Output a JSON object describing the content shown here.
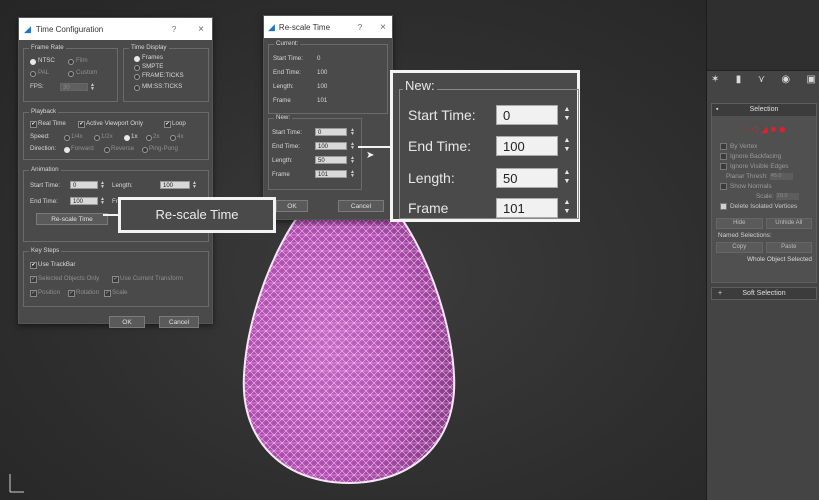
{
  "time_config": {
    "title": "Time Configuration",
    "help": "?",
    "close": "×",
    "frame_rate": {
      "label": "Frame Rate",
      "ntsc": "NTSC",
      "film": "Film",
      "pal": "PAL",
      "custom": "Custom",
      "fps_label": "FPS:",
      "fps_value": "30"
    },
    "time_display": {
      "label": "Time Display",
      "frames": "Frames",
      "smpte": "SMPTE",
      "frame_ticks": "FRAME:TICKS",
      "mm_ss_ticks": "MM:SS:TICKS"
    },
    "playback": {
      "label": "Playback",
      "real_time": "Real Time",
      "active_viewport_only": "Active Viewport Only",
      "loop": "Loop",
      "speed_label": "Speed:",
      "speeds": [
        "1/4x",
        "1/2x",
        "1x",
        "2x",
        "4x"
      ],
      "direction_label": "Direction:",
      "forward": "Forward",
      "reverse": "Reverse",
      "ping_pong": "Ping-Pong"
    },
    "animation": {
      "label": "Animation",
      "start_time_label": "Start Time:",
      "start_time_value": "0",
      "length_label": "Length:",
      "length_value": "100",
      "end_time_label": "End Time:",
      "end_time_value": "100",
      "frame_label": "Fr",
      "rescale_button": "Re-scale Time"
    },
    "key_steps": {
      "label": "Key Steps",
      "use_trackbar": "Use TrackBar",
      "selected_objects_only": "Selected Objects Only",
      "use_current_transform": "Use Current Transform",
      "position": "Position",
      "rotation": "Rotation",
      "scale": "Scale"
    },
    "ok": "OK",
    "cancel": "Cancel"
  },
  "rescale_dialog": {
    "title": "Re-scale Time",
    "help": "?",
    "close": "×",
    "current": {
      "label": "Current:",
      "start_time_label": "Start Time:",
      "start_time_value": "0",
      "end_time_label": "End Time:",
      "end_time_value": "100",
      "length_label": "Length:",
      "length_value": "100",
      "frame_label": "Frame",
      "frame_value": "101"
    },
    "new": {
      "label": "New:",
      "start_time_label": "Start Time:",
      "start_time_value": "0",
      "end_time_label": "End Time:",
      "end_time_value": "100",
      "length_label": "Length:",
      "length_value": "50",
      "frame_label": "Frame",
      "frame_value": "101"
    },
    "ok": "OK",
    "cancel": "Cancel"
  },
  "zoom_callout": {
    "label": "New:",
    "start_time_label": "Start Time:",
    "start_time_value": "0",
    "end_time_label": "End Time:",
    "end_time_value": "100",
    "length_label": "Length:",
    "length_value": "50",
    "frame_label": "Frame",
    "frame_value": "101"
  },
  "rescale_callout": {
    "label": "Re-scale Time"
  },
  "command_panel": {
    "selection": {
      "label": "Selection",
      "by_vertex": "By Vertex",
      "ignore_backfacing": "Ignore Backfacing",
      "ignore_visible_edges": "Ignore Visible Edges",
      "planar_thresh_label": "Planar Thresh:",
      "planar_thresh_value": "45.0",
      "show_normals": "Show Normals",
      "scale_label": "Scale:",
      "scale_value": "20.0",
      "delete_isolated_vertices": "Delete Isolated Vertices",
      "hide": "Hide",
      "unhide_all": "Unhide All",
      "named_selections": "Named Selections:",
      "copy": "Copy",
      "paste": "Paste",
      "status": "Whole Object Selected"
    },
    "soft_selection": {
      "plus": "+",
      "label": "Soft Selection"
    }
  },
  "colors": {
    "egg": "#b94fb8",
    "callout_border": "#f3f3f3",
    "selection_icons": "#e0202a",
    "dialog_bg": "#4a4a4a"
  }
}
